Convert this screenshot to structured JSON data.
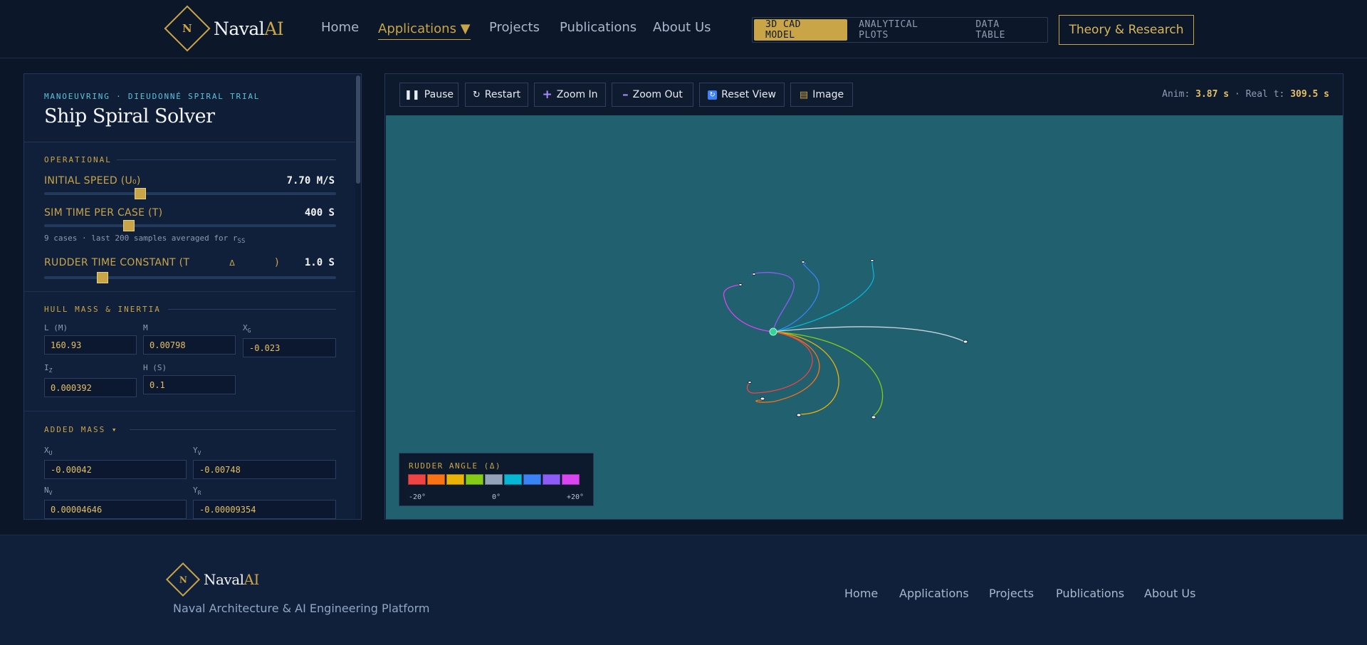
{
  "brand": {
    "name": "Naval",
    "ai": "AI",
    "initial": "N"
  },
  "nav": {
    "home": "Home",
    "applications": "Applications ▼",
    "projects": "Projects",
    "publications": "Publications",
    "about": "About Us"
  },
  "modes": [
    "3D CAD MODEL",
    "ANALYTICAL PLOTS",
    "DATA TABLE"
  ],
  "active_mode": "3D CAD MODEL",
  "theory_button": "Theory & Research",
  "panel": {
    "eyebrow": "MANOEUVRING · DIEUDONNÉ SPIRAL TRIAL",
    "title": "Ship Spiral Solver",
    "operational": {
      "label": "OPERATIONAL",
      "initial_speed": {
        "label": "INITIAL SPEED (U₀)",
        "value": "7.70 M/S",
        "fraction": 0.33
      },
      "sim_time": {
        "label": "SIM TIME PER CASE (T)",
        "value": "400 S",
        "fraction": 0.29
      },
      "hint_main": "9 cases · last 200 samples averaged for r",
      "hint_sub": "SS",
      "rudder_tc": {
        "label": "RUDDER TIME CONSTANT (T",
        "label_sub": "Δ",
        "label_end": ")",
        "value": "1.0 S",
        "fraction": 0.2
      }
    },
    "hull": {
      "label": "HULL MASS & INERTIA",
      "L": {
        "label": "L (M)",
        "value": "160.93"
      },
      "M": {
        "label": "M",
        "value": "0.00798"
      },
      "XG": {
        "label": "X",
        "sub": "G",
        "value": "-0.023"
      },
      "IZ": {
        "label": "I",
        "sub": "Z",
        "value": "0.000392"
      },
      "H": {
        "label": "H (S)",
        "value": "0.1"
      }
    },
    "added_mass": {
      "label": "ADDED MASS ▾",
      "XU": {
        "label": "X",
        "sub": "U",
        "value": "-0.00042"
      },
      "YV": {
        "label": "Y",
        "sub": "V",
        "value": "-0.00748"
      },
      "NV": {
        "label": "N",
        "sub": "V",
        "value": "0.00004646"
      },
      "YR": {
        "label": "Y",
        "sub": "R",
        "value": "-0.00009354"
      }
    }
  },
  "toolbar": {
    "pause": "Pause",
    "restart": "Restart",
    "zoom_in": "Zoom In",
    "zoom_out": "Zoom Out",
    "reset_view": "Reset View",
    "image": "Image",
    "anim_label": "Anim: ",
    "anim_value": "3.87 s",
    "sep": " · ",
    "real_label": "Real t: ",
    "real_value": "309.5 s"
  },
  "legend": {
    "title": "RUDDER ANGLE (Δ)",
    "min": "-20°",
    "mid": "0°",
    "max": "+20°",
    "colors": [
      "#ef4444",
      "#f97316",
      "#eab308",
      "#84cc16",
      "#94a3b8",
      "#06b6d4",
      "#3b82f6",
      "#8b5cf6",
      "#d946ef"
    ]
  },
  "footer": {
    "tagline": "Naval Architecture & AI Engineering Platform",
    "links": [
      "Home",
      "Applications",
      "Projects",
      "Publications",
      "About Us"
    ]
  }
}
